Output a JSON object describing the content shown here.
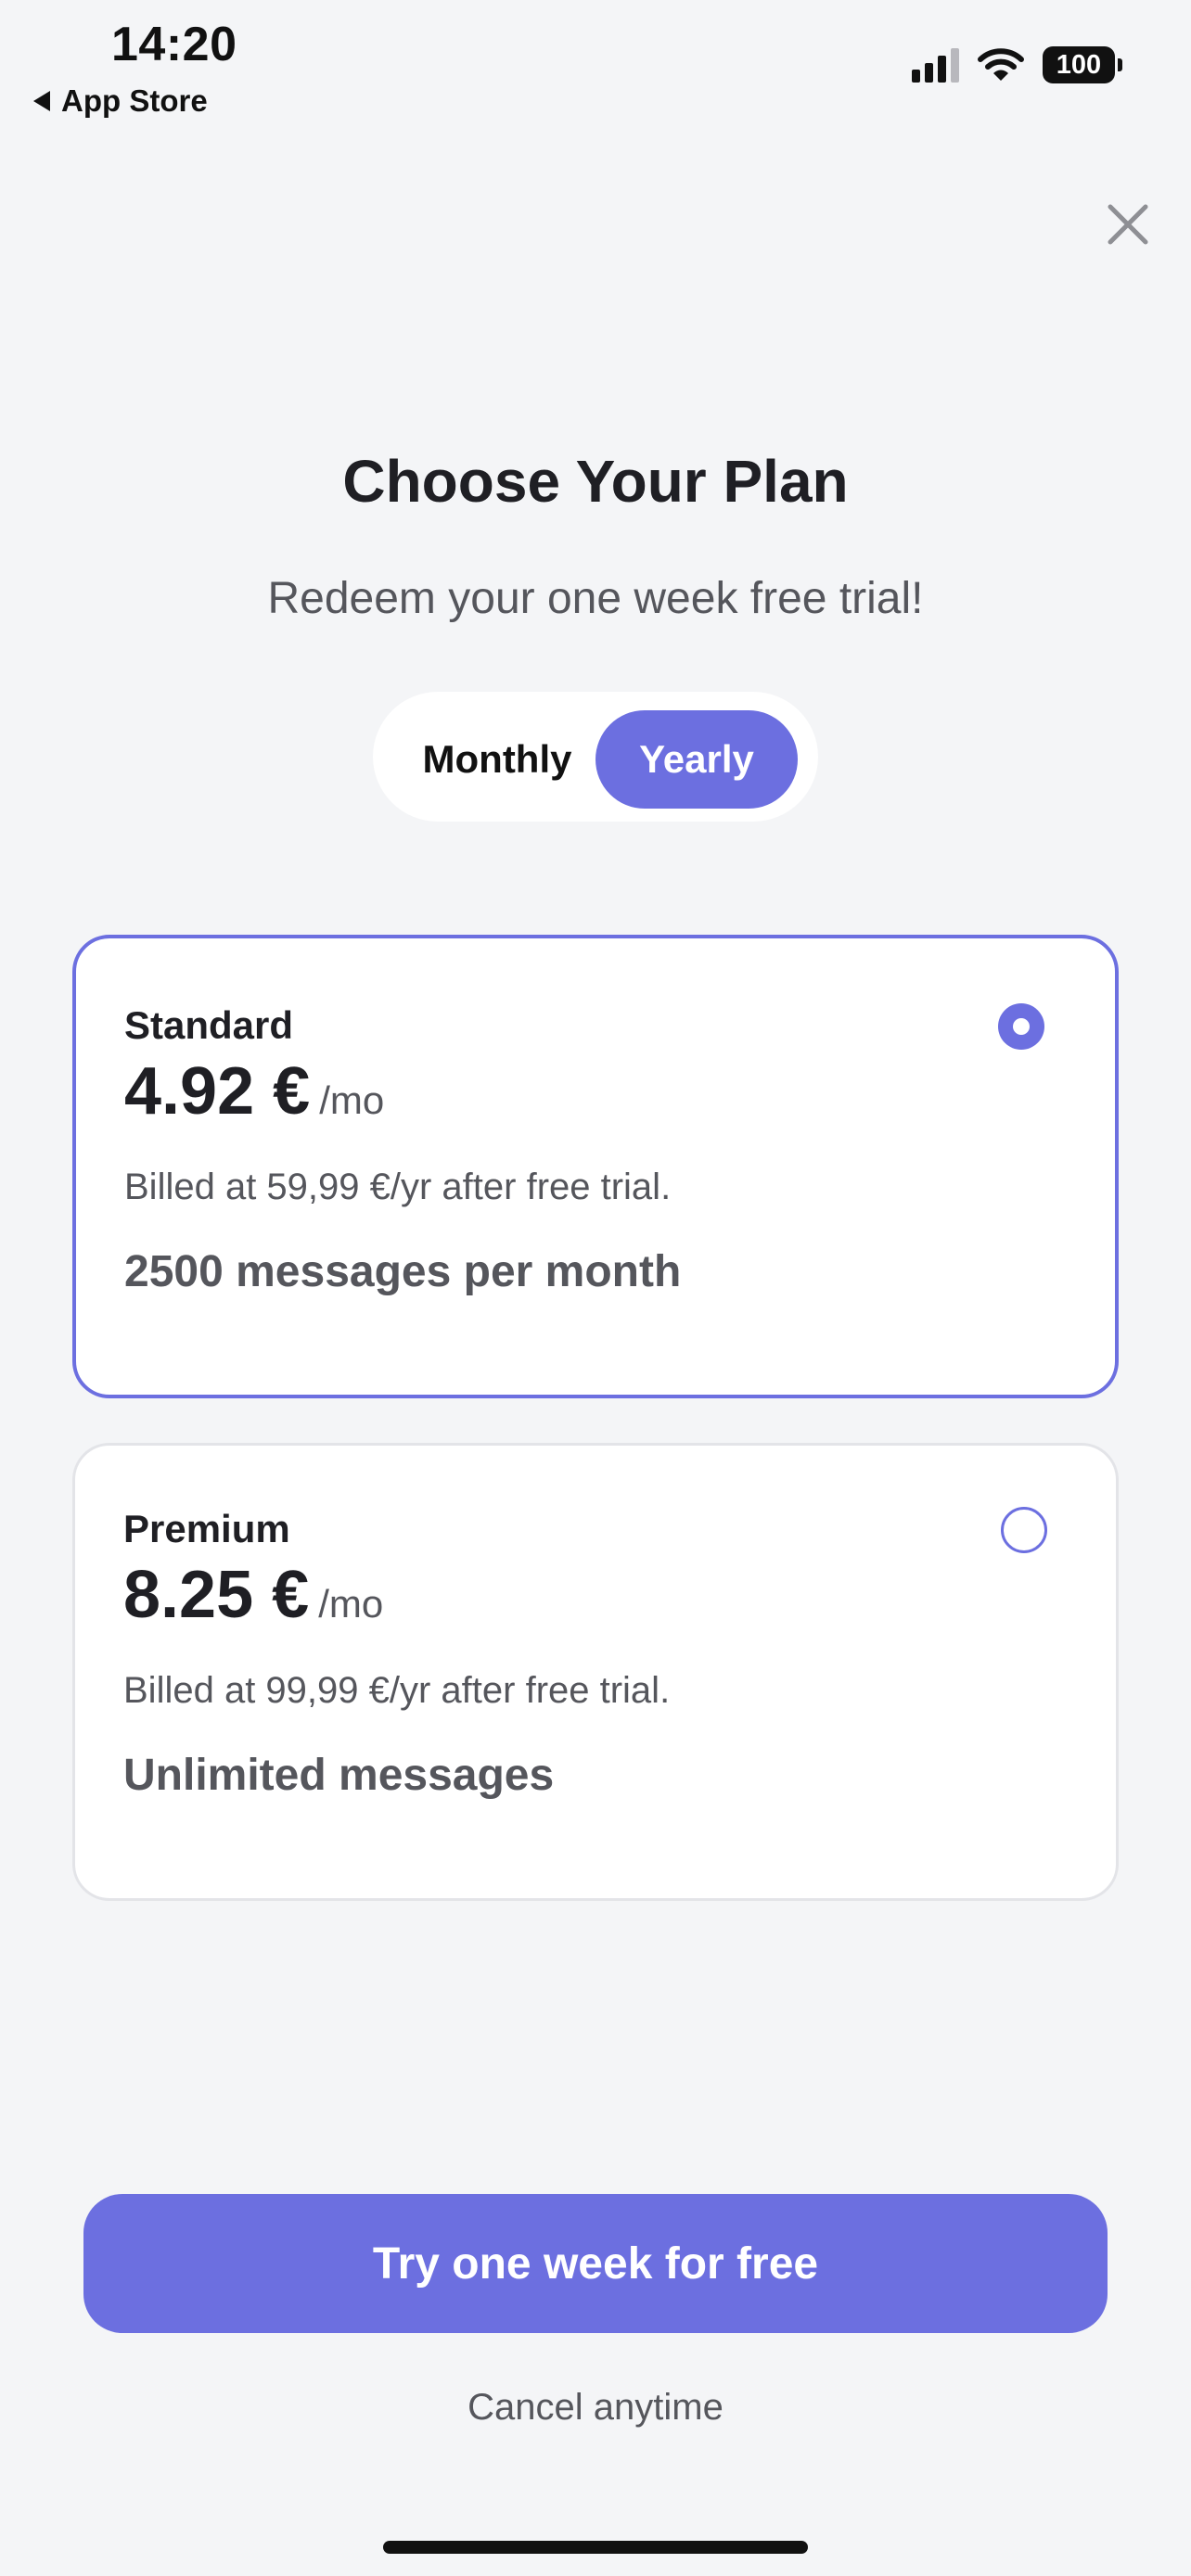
{
  "status_bar": {
    "time": "14:20",
    "back_label": "App Store",
    "battery": "100"
  },
  "header": {
    "title": "Choose Your Plan",
    "subtitle": "Redeem your one week free trial!"
  },
  "billing_toggle": {
    "options": [
      "Monthly",
      "Yearly"
    ],
    "selected": "Yearly"
  },
  "plans": [
    {
      "name": "Standard",
      "price": "4.92 €",
      "period": "/mo",
      "billing": "Billed at 59,99 €/yr after free trial.",
      "feature": "2500 messages per month",
      "selected": true
    },
    {
      "name": "Premium",
      "price": "8.25 €",
      "period": "/mo",
      "billing": "Billed at 99,99 €/yr after free trial.",
      "feature": "Unlimited messages",
      "selected": false
    }
  ],
  "cta": {
    "label": "Try one week for free",
    "note": "Cancel anytime"
  },
  "colors": {
    "accent": "#6c6fe0",
    "background": "#f4f5f7",
    "text_primary": "#1f1f24",
    "text_secondary": "#55565c"
  }
}
